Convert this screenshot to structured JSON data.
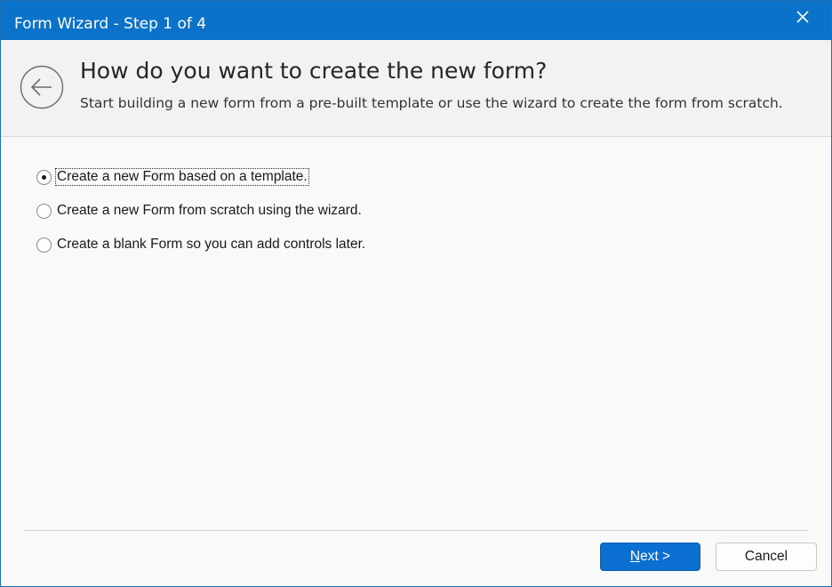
{
  "window": {
    "title": "Form Wizard - Step 1 of 4"
  },
  "header": {
    "heading": "How do you want to create the new form?",
    "subheading": "Start building a new form from a pre-built template or use the wizard to create the form from scratch."
  },
  "options": [
    {
      "label": "Create a new Form based on a template.",
      "checked": true
    },
    {
      "label": "Create a new Form from scratch using the wizard.",
      "checked": false
    },
    {
      "label": "Create a blank Form so you can add controls later.",
      "checked": false
    }
  ],
  "buttons": {
    "next_accel": "N",
    "next_rest": "ext >",
    "cancel": "Cancel"
  },
  "icons": {
    "close": "close-icon",
    "back": "back-arrow-icon"
  },
  "colors": {
    "titlebar": "#0a73c9",
    "primary_button": "#0a6fd0"
  }
}
